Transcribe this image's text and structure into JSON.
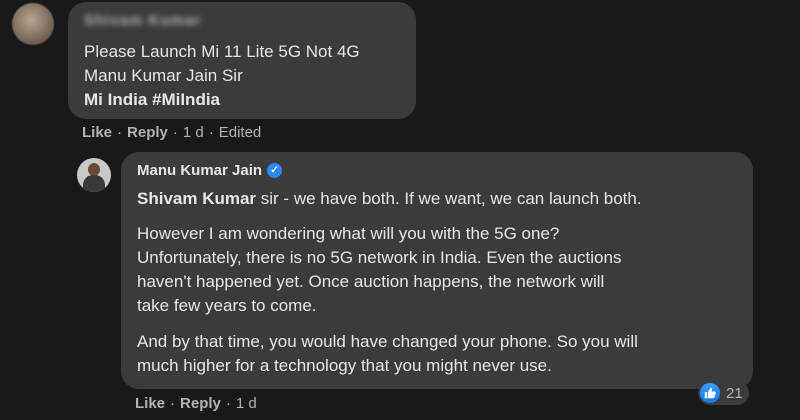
{
  "comment": {
    "author_name_obscured": "Shivam Kumar",
    "lines": [
      "Please Launch Mi 11 Lite 5G Not 4G",
      "Manu Kumar Jain Sir",
      "Mi India #MiIndia"
    ],
    "actions": {
      "like": "Like",
      "reply": "Reply",
      "time": "1 d",
      "edited": "Edited"
    }
  },
  "reply": {
    "author": "Manu Kumar Jain",
    "verified_icon": "verified-badge-icon",
    "mention": "Shivam Kumar",
    "line1_rest": " sir - we have both. If we want, we can launch both.",
    "para2": [
      "However I am wondering what will you with the 5G one?",
      "Unfortunately, there is no 5G network in India. Even the auctions",
      "haven't happened yet. Once auction happens, the network will",
      "take few years to come."
    ],
    "para3": [
      "And by that time, you would have changed your phone. So you will",
      "much higher for a technology that you might never use."
    ],
    "actions": {
      "like": "Like",
      "reply": "Reply",
      "time": "1 d"
    },
    "reactions": {
      "icon": "thumbs-up-icon",
      "count": "21"
    }
  },
  "colors": {
    "background": "#18191a",
    "bubble": "#3a3b3c",
    "text": "#e4e6eb",
    "secondary_text": "#b0b3b8",
    "accent": "#1877f2"
  }
}
